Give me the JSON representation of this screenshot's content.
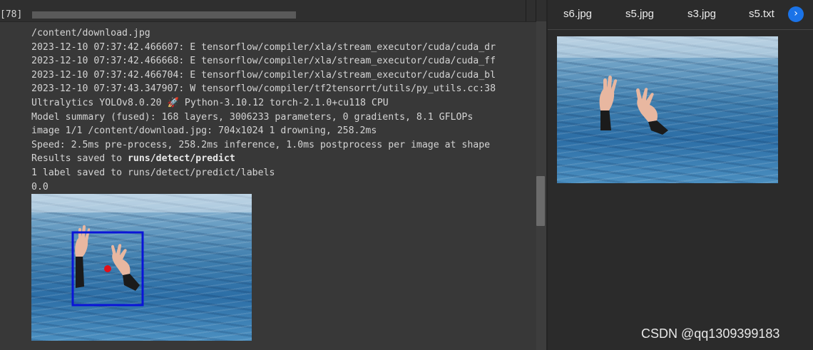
{
  "cell": {
    "execution_count": "[78]",
    "output_lines": [
      "/content/download.jpg",
      "2023-12-10 07:37:42.466607: E tensorflow/compiler/xla/stream_executor/cuda/cuda_dr",
      "2023-12-10 07:37:42.466668: E tensorflow/compiler/xla/stream_executor/cuda/cuda_ff",
      "2023-12-10 07:37:42.466704: E tensorflow/compiler/xla/stream_executor/cuda/cuda_bl",
      "2023-12-10 07:37:43.347907: W tensorflow/compiler/tf2tensorrt/utils/py_utils.cc:38",
      "Ultralytics YOLOv8.0.20 🚀 Python-3.10.12 torch-2.1.0+cu118 CPU",
      "Model summary (fused): 168 layers, 3006233 parameters, 0 gradients, 8.1 GFLOPs",
      "image 1/1 /content/download.jpg: 704x1024 1 drowning, 258.2ms",
      "Speed: 2.5ms pre-process, 258.2ms inference, 1.0ms postprocess per image at shape"
    ],
    "results_prefix": "Results saved to ",
    "results_path": "runs/detect/predict",
    "label_line": "1 label saved to runs/detect/predict/labels",
    "value_line": "0.0"
  },
  "detection": {
    "box_color": "#0a14d8",
    "point_color": "#e0101a"
  },
  "panel": {
    "tabs": [
      "s6.jpg",
      "s5.jpg",
      "s3.jpg",
      "s5.txt"
    ],
    "next_icon": "chevron-right-icon",
    "next_symbol": "›",
    "accent_color": "#1a73e8"
  },
  "watermark": "CSDN @qq1309399183"
}
